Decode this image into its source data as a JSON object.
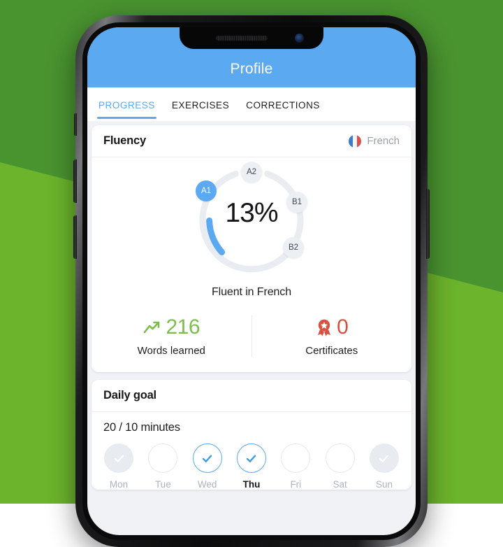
{
  "background": {
    "top_green": "#4a9430",
    "bottom_green": "#6cb42c"
  },
  "device": {
    "notch": {
      "speaker_icon": "speaker-grille-icon",
      "camera_icon": "front-camera-icon"
    },
    "buttons": [
      "mute-switch",
      "volume-up-button",
      "volume-down-button",
      "power-button"
    ]
  },
  "header": {
    "title": "Profile",
    "color": "#5ba9f0"
  },
  "tabs": [
    {
      "label": "PROGRESS",
      "active": true
    },
    {
      "label": "EXERCISES",
      "active": false
    },
    {
      "label": "CORRECTIONS",
      "active": false
    }
  ],
  "fluency_card": {
    "title": "Fluency",
    "language": "French",
    "flag_icon": "french-flag-icon",
    "percent": "13%",
    "caption": "Fluent in French",
    "levels": [
      {
        "label": "A1",
        "reached": true
      },
      {
        "label": "A2",
        "reached": false
      },
      {
        "label": "B1",
        "reached": false
      },
      {
        "label": "B2",
        "reached": false
      }
    ],
    "stats": [
      {
        "icon": "trending-up-icon",
        "value": "216",
        "label": "Words learned",
        "color": "#7cbd4e"
      },
      {
        "icon": "award-medal-icon",
        "value": "0",
        "label": "Certificates",
        "color": "#d9503f"
      }
    ]
  },
  "daily_goal_card": {
    "title": "Daily goal",
    "minutes": "20 / 10 minutes",
    "days": [
      {
        "name": "Mon",
        "state": "done",
        "today": false
      },
      {
        "name": "Tue",
        "state": "empty",
        "today": false
      },
      {
        "name": "Wed",
        "state": "active",
        "today": false
      },
      {
        "name": "Thu",
        "state": "active",
        "today": true
      },
      {
        "name": "Fri",
        "state": "empty",
        "today": false
      },
      {
        "name": "Sat",
        "state": "empty",
        "today": false
      },
      {
        "name": "Sun",
        "state": "done",
        "today": false
      }
    ]
  }
}
